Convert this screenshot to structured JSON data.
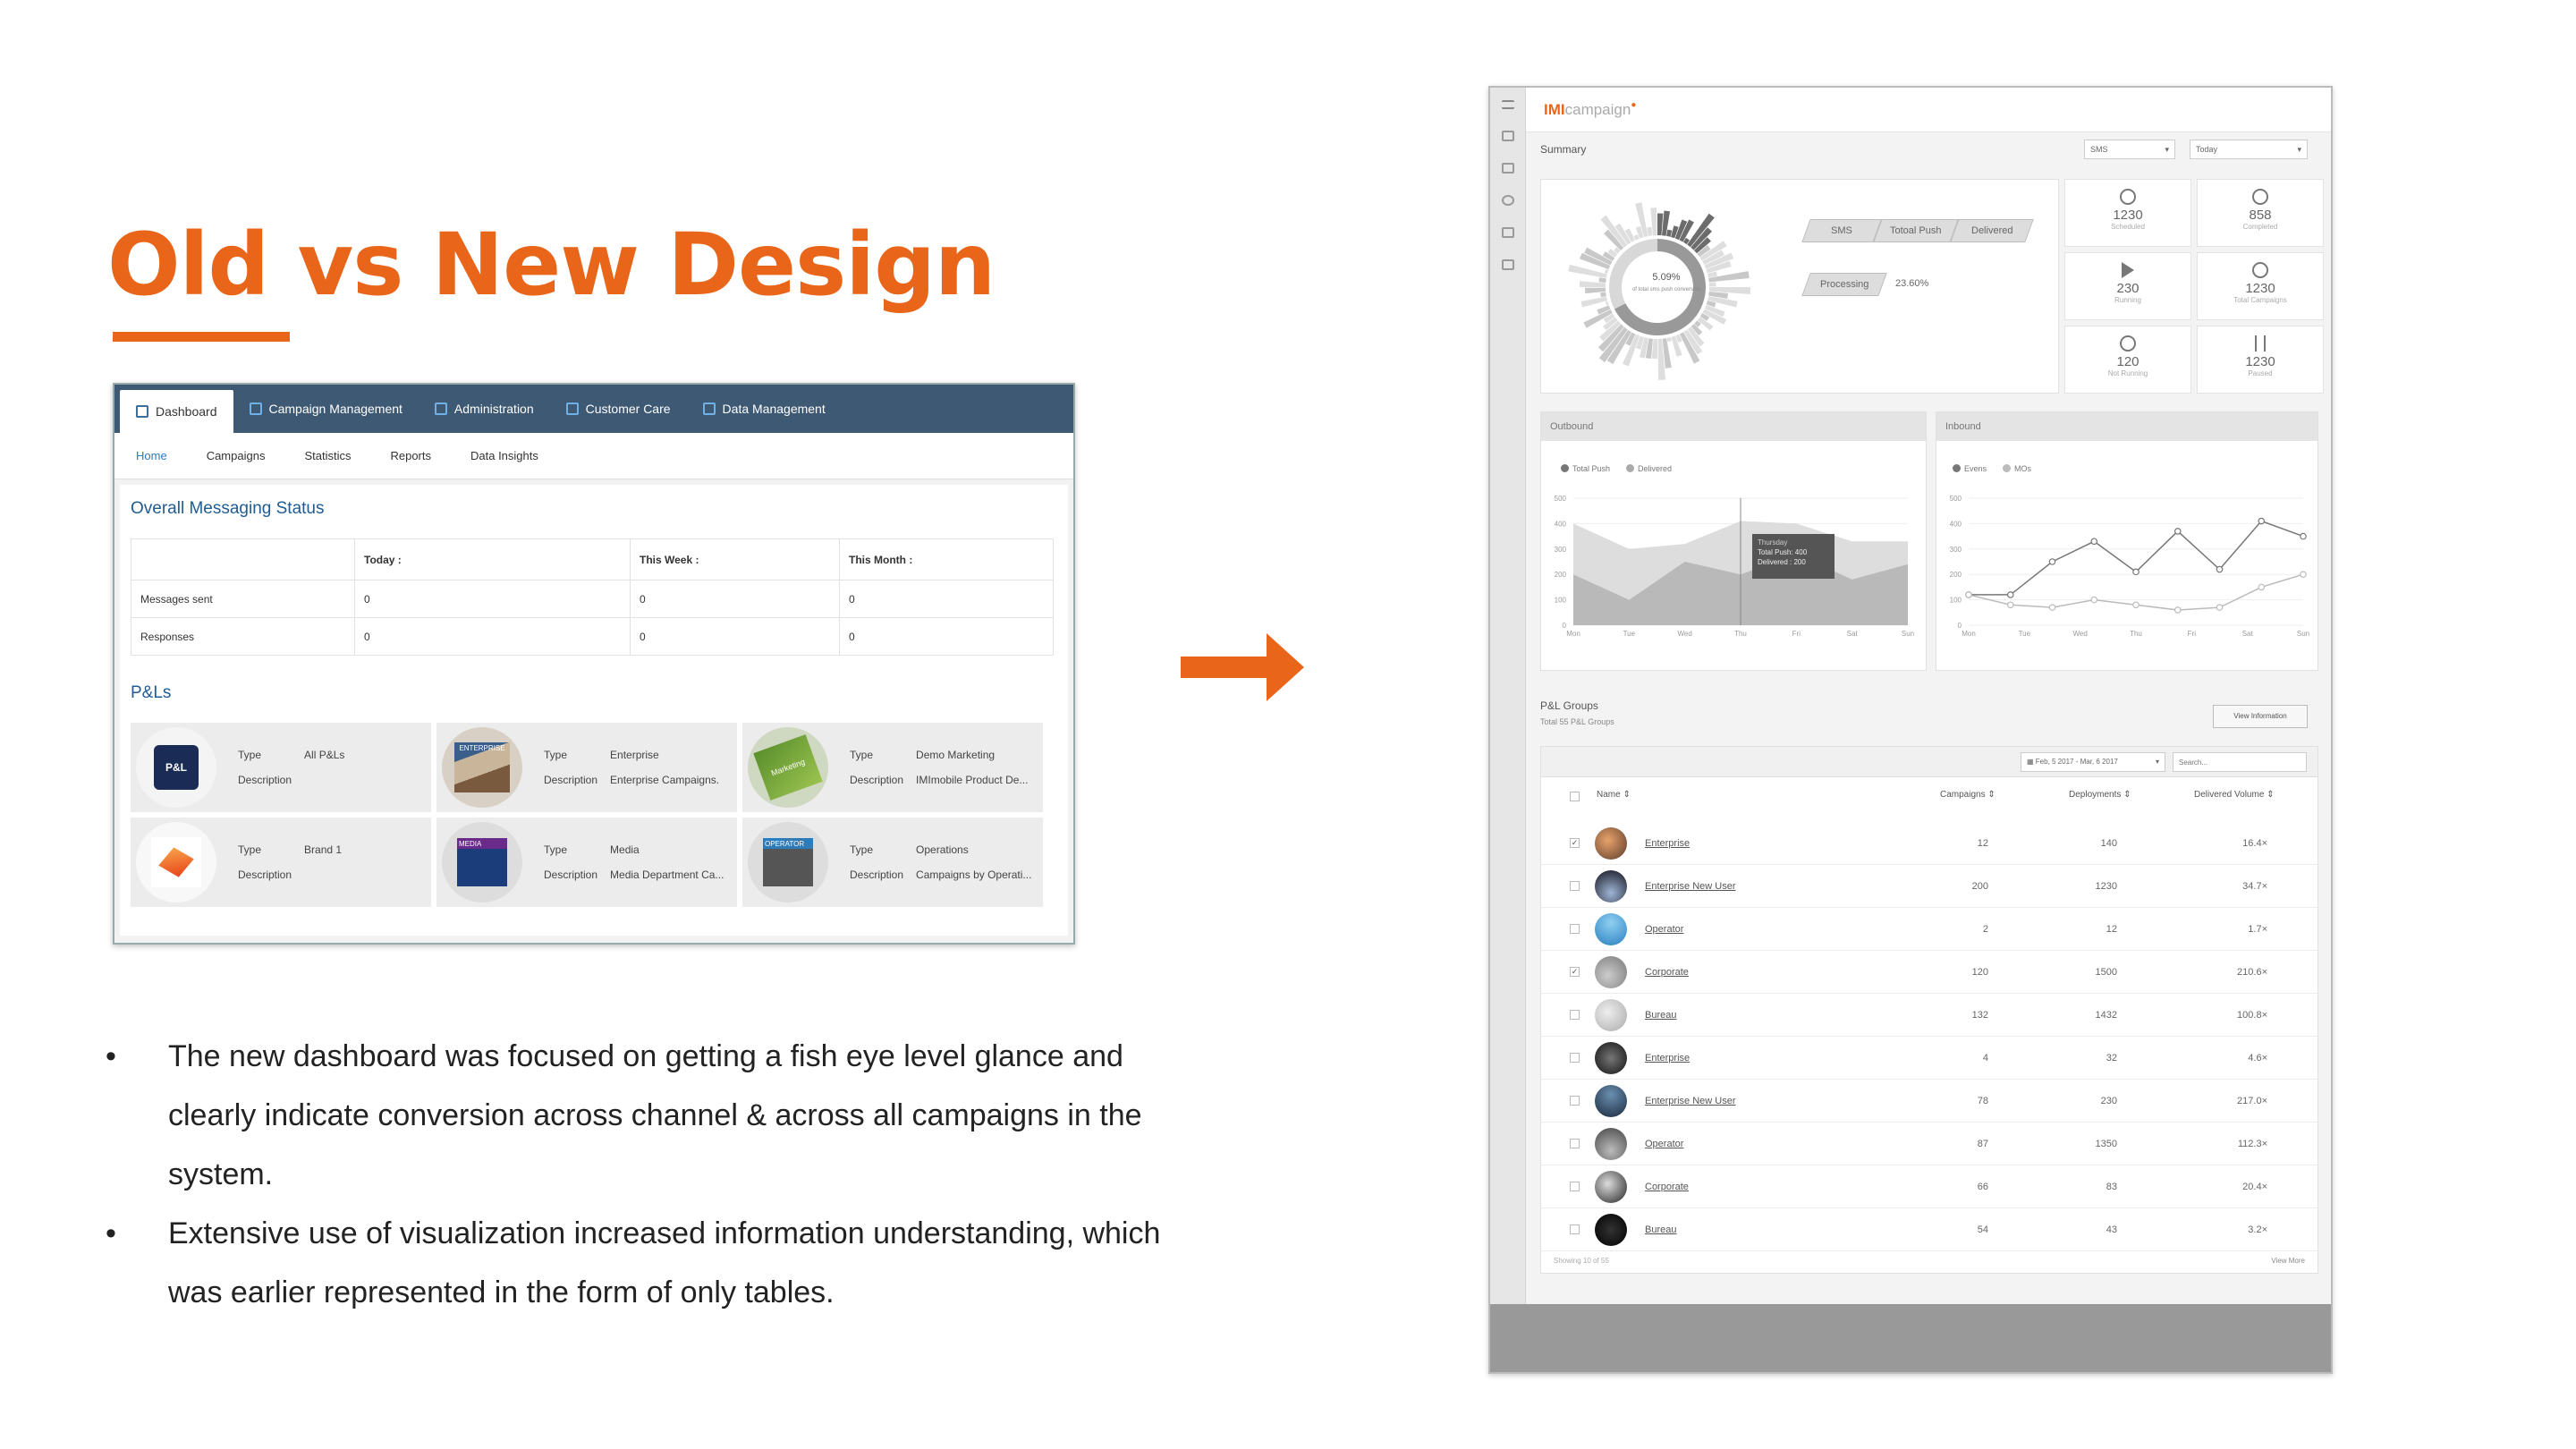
{
  "slide": {
    "title": "Old vs New Design",
    "accent_color": "#e8651a",
    "bullets": [
      "The new dashboard was focused on getting a fish eye level glance and clearly indicate conversion across channel & across all campaigns in the system.",
      "Extensive use of visualization increased information understanding, which was earlier represented in the form of only tables."
    ]
  },
  "old_ui": {
    "nav": [
      {
        "label": "Dashboard",
        "icon": "chart-icon",
        "active": true
      },
      {
        "label": "Campaign Management",
        "icon": "document-icon"
      },
      {
        "label": "Administration",
        "icon": "gears-icon"
      },
      {
        "label": "Customer Care",
        "icon": "headset-icon"
      },
      {
        "label": "Data Management",
        "icon": "database-icon"
      }
    ],
    "subnav": [
      "Home",
      "Campaigns",
      "Statistics",
      "Reports",
      "Data Insights"
    ],
    "status_heading": "Overall Messaging Status",
    "table": {
      "headers": [
        "",
        "Today :",
        "This Week :",
        "This Month :"
      ],
      "rows": [
        [
          "Messages sent",
          "0",
          "0",
          "0"
        ],
        [
          "Responses",
          "0",
          "0",
          "0"
        ]
      ]
    },
    "pl_heading": "P&Ls",
    "labels": {
      "type": "Type",
      "description": "Description"
    },
    "pl_cards": [
      {
        "type": "All P&Ls",
        "description": "",
        "image_text": "P&L"
      },
      {
        "type": "Enterprise",
        "description": "Enterprise Campaigns.",
        "image_text": "ENTERPRISE"
      },
      {
        "type": "Demo Marketing",
        "description": "IMImobile Product De...",
        "image_text": "Marketing"
      },
      {
        "type": "Brand 1",
        "description": "",
        "image_text": ""
      },
      {
        "type": "Media",
        "description": "Media Department Ca...",
        "image_text": "MEDIA"
      },
      {
        "type": "Operations",
        "description": "Campaigns by Operati...",
        "image_text": "OPERATOR"
      }
    ]
  },
  "new_ui": {
    "logo_prefix": "IMI",
    "logo_suffix": "campaign",
    "summary_title": "Summary",
    "channel_select": "SMS",
    "date_select": "Today",
    "donut_center": "5.09%",
    "donut_caption": "of total sms push conversion",
    "funnel": [
      "SMS",
      "Totoal Push",
      "Delivered"
    ],
    "processing_label": "Processing",
    "processing_value": "23.60%",
    "kpis": [
      {
        "value": "1230",
        "label": "Scheduled",
        "icon": "clock-icon"
      },
      {
        "value": "858",
        "label": "Completed",
        "icon": "check-circle-icon"
      },
      {
        "value": "230",
        "label": "Running",
        "icon": "play-icon"
      },
      {
        "value": "1230",
        "label": "Total Campaigns",
        "icon": "clock-icon"
      },
      {
        "value": "120",
        "label": "Not Running",
        "icon": "clock-icon"
      },
      {
        "value": "1230",
        "label": "Paused",
        "icon": "pause-icon"
      }
    ],
    "outbound": {
      "title": "Outbound",
      "legend": [
        "Total Push",
        "Delivered"
      ],
      "tooltip": {
        "day": "Thursday",
        "line1": "Total Push: 400",
        "line2": "Delivered : 200"
      }
    },
    "inbound": {
      "title": "Inbound",
      "legend": [
        "Evens",
        "MOs"
      ]
    },
    "groups": {
      "title": "P&L Groups",
      "subtitle": "Total 55 P&L Groups",
      "view_button": "View Information",
      "date_range": "Feb, 5 2017 - Mar, 6 2017",
      "search_placeholder": "Search...",
      "columns": [
        "Name",
        "Campaigns",
        "Deployments",
        "Delivered Volume"
      ],
      "rows": [
        {
          "name": "Enterprise",
          "campaigns": "12",
          "deployments": "140",
          "volume": "16.4×",
          "checked": true
        },
        {
          "name": "Enterprise New User",
          "campaigns": "200",
          "deployments": "1230",
          "volume": "34.7×",
          "checked": false
        },
        {
          "name": "Operator",
          "campaigns": "2",
          "deployments": "12",
          "volume": "1.7×",
          "checked": false
        },
        {
          "name": "Corporate",
          "campaigns": "120",
          "deployments": "1500",
          "volume": "210.6×",
          "checked": true
        },
        {
          "name": "Bureau",
          "campaigns": "132",
          "deployments": "1432",
          "volume": "100.8×",
          "checked": false
        },
        {
          "name": "Enterprise",
          "campaigns": "4",
          "deployments": "32",
          "volume": "4.6×",
          "checked": false
        },
        {
          "name": "Enterprise New User",
          "campaigns": "78",
          "deployments": "230",
          "volume": "217.0×",
          "checked": false
        },
        {
          "name": "Operator",
          "campaigns": "87",
          "deployments": "1350",
          "volume": "112.3×",
          "checked": false
        },
        {
          "name": "Corporate",
          "campaigns": "66",
          "deployments": "83",
          "volume": "20.4×",
          "checked": false
        },
        {
          "name": "Bureau",
          "campaigns": "54",
          "deployments": "43",
          "volume": "3.2×",
          "checked": false
        }
      ],
      "footer_left": "Showing 10 of 55",
      "footer_right": "View More"
    }
  },
  "chart_data": [
    {
      "type": "area",
      "title": "Outbound",
      "categories": [
        "Mon",
        "Tue",
        "Wed",
        "Thu",
        "Fri",
        "Sat",
        "Sun"
      ],
      "ylim": [
        0,
        500
      ],
      "yticks": [
        0,
        100,
        200,
        300,
        400,
        500
      ],
      "series": [
        {
          "name": "Total Push",
          "values": [
            400,
            300,
            320,
            410,
            400,
            330,
            330
          ]
        },
        {
          "name": "Delivered",
          "values": [
            200,
            100,
            250,
            200,
            280,
            180,
            240
          ]
        }
      ]
    },
    {
      "type": "line",
      "title": "Inbound",
      "categories": [
        "Mon",
        "Tue",
        "Wed",
        "Thu",
        "Fri",
        "Sat",
        "Sun"
      ],
      "ylim": [
        0,
        500
      ],
      "yticks": [
        0,
        100,
        200,
        300,
        400,
        500
      ],
      "series": [
        {
          "name": "Evens",
          "values": [
            120,
            120,
            250,
            330,
            210,
            370,
            220,
            410,
            350
          ]
        },
        {
          "name": "MOs",
          "values": [
            120,
            80,
            70,
            100,
            80,
            60,
            70,
            150,
            200
          ]
        }
      ]
    }
  ]
}
